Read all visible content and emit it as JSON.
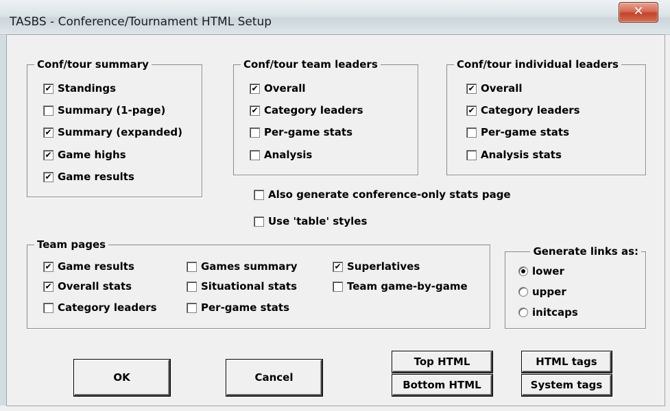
{
  "window": {
    "title": "TASBS - Conference/Tournament HTML Setup",
    "close_symbol": "✕"
  },
  "conf_summary": {
    "legend": "Conf/tour summary",
    "items": [
      {
        "label": "Standings",
        "checked": true
      },
      {
        "label": "Summary (1-page)",
        "checked": false
      },
      {
        "label": "Summary (expanded)",
        "checked": true
      },
      {
        "label": "Game highs",
        "checked": true
      },
      {
        "label": "Game results",
        "checked": true
      }
    ]
  },
  "team_leaders": {
    "legend": "Conf/tour team leaders",
    "items": [
      {
        "label": "Overall",
        "checked": true
      },
      {
        "label": "Category leaders",
        "checked": true
      },
      {
        "label": "Per-game stats",
        "checked": false
      },
      {
        "label": "Analysis",
        "checked": false
      }
    ]
  },
  "individual_leaders": {
    "legend": "Conf/tour individual leaders",
    "items": [
      {
        "label": "Overall",
        "checked": true
      },
      {
        "label": "Category leaders",
        "checked": true
      },
      {
        "label": "Per-game stats",
        "checked": false
      },
      {
        "label": "Analysis stats",
        "checked": false
      }
    ]
  },
  "options": [
    {
      "label": "Also generate conference-only stats page",
      "checked": false
    },
    {
      "label": "Use 'table' styles",
      "checked": false
    }
  ],
  "team_pages": {
    "legend": "Team pages",
    "items": [
      {
        "label": "Game results",
        "checked": true
      },
      {
        "label": "Overall stats",
        "checked": true
      },
      {
        "label": "Category leaders",
        "checked": false
      },
      {
        "label": "Games summary",
        "checked": false
      },
      {
        "label": "Situational stats",
        "checked": false
      },
      {
        "label": "Per-game stats",
        "checked": false
      },
      {
        "label": "Superlatives",
        "checked": true
      },
      {
        "label": "Team game-by-game",
        "checked": false
      }
    ]
  },
  "links": {
    "legend": "Generate links as:",
    "options": [
      {
        "label": "lower",
        "selected": true
      },
      {
        "label": "upper",
        "selected": false
      },
      {
        "label": "initcaps",
        "selected": false
      }
    ]
  },
  "buttons": {
    "ok": "OK",
    "cancel": "Cancel",
    "top_html": "Top HTML",
    "bottom_html": "Bottom HTML",
    "html_tags": "HTML tags",
    "system_tags": "System tags"
  },
  "colors": {
    "close_button": "#c2442a",
    "dialog_bg": "#f0f0f0"
  }
}
